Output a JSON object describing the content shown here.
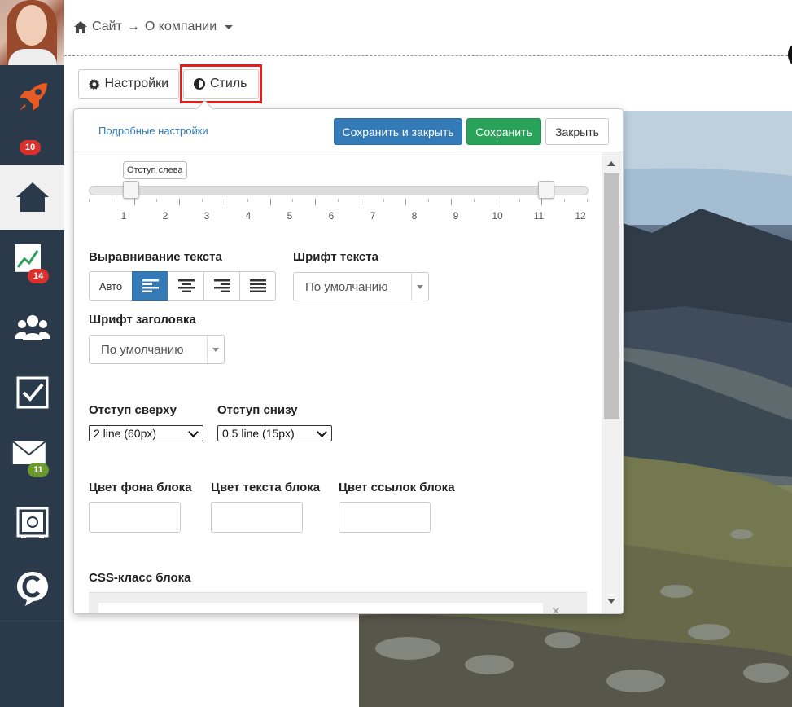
{
  "breadcrumb": {
    "home_icon": "home-icon",
    "site": "Сайт",
    "arrow": "→",
    "page": "О компании"
  },
  "sidebar": {
    "items": [
      {
        "name": "rocket",
        "icon": "rocket-icon"
      },
      {
        "name": "badge",
        "badge": "10"
      },
      {
        "name": "home",
        "icon": "home-icon",
        "active": true
      },
      {
        "name": "stats",
        "icon": "chart-icon",
        "badge": "14"
      },
      {
        "name": "users",
        "icon": "users-icon"
      },
      {
        "name": "tasks",
        "icon": "checkbox-icon"
      },
      {
        "name": "mail",
        "icon": "mail-icon",
        "badge": "11"
      },
      {
        "name": "safe",
        "icon": "safe-icon"
      },
      {
        "name": "chat",
        "icon": "chat-c-icon"
      }
    ]
  },
  "tabs": {
    "settings": "Настройки",
    "style": "Стиль"
  },
  "panel": {
    "link_detailed": "Подробные настройки",
    "save_close": "Сохранить и закрыть",
    "save": "Сохранить",
    "close": "Закрыть",
    "slider": {
      "tooltip": "Отступ слева",
      "min": 1,
      "max": 12,
      "left_value": 1,
      "right_value": 11,
      "labels": [
        "1",
        "2",
        "3",
        "4",
        "5",
        "6",
        "7",
        "8",
        "9",
        "10",
        "11",
        "12"
      ]
    },
    "text_align": {
      "label": "Выравнивание текста",
      "auto": "Авто",
      "active": "left"
    },
    "text_font": {
      "label": "Шрифт текста",
      "value": "По умолчанию"
    },
    "heading_font": {
      "label": "Шрифт заголовка",
      "value": "По умолчанию"
    },
    "padding_top": {
      "label": "Отступ сверху",
      "value": "2 line (60px)"
    },
    "padding_bottom": {
      "label": "Отступ снизу",
      "value": "0.5 line (15px)"
    },
    "bg_color": {
      "label": "Цвет фона блока"
    },
    "text_color": {
      "label": "Цвет текста блока"
    },
    "link_color": {
      "label": "Цвет ссылок блока"
    },
    "css_class": {
      "label": "CSS-класс блока"
    }
  },
  "colors": {
    "primary": "#337ab7",
    "success": "#2aa35a",
    "danger": "#d9302c",
    "sidebar": "#2b3a4a",
    "highlight": "#e01f1f"
  }
}
